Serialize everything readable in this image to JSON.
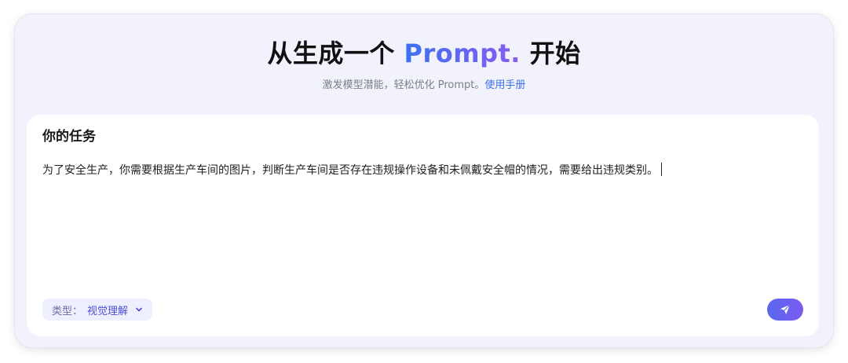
{
  "header": {
    "title_prefix": "从生成一个 ",
    "title_accent": "Prompt.",
    "title_suffix": " 开始",
    "subtitle": "激发模型潜能，轻松优化 Prompt。",
    "subtitle_link": "使用手册"
  },
  "card": {
    "heading": "你的任务",
    "task_text": "为了安全生产，你需要根据生产车间的图片，判断生产车间是否存在违规操作设备和未佩戴安全帽的情况，需要给出违规类别。",
    "type_label": "类型：",
    "type_value": "视觉理解"
  },
  "icons": {
    "type_dropdown": "chevron-down-icon",
    "send": "send-icon"
  },
  "colors": {
    "accent_start": "#3b72f2",
    "accent_end": "#8a5cf0",
    "link": "#3b6fea",
    "send_button": "#6360ef"
  }
}
